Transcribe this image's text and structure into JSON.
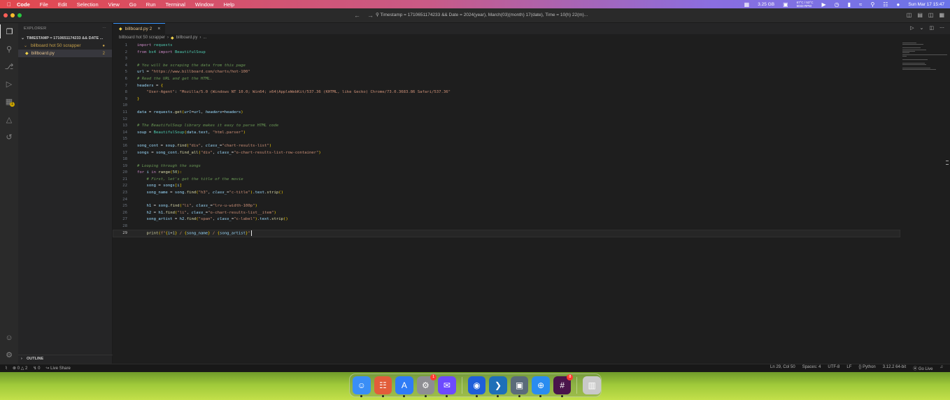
{
  "menubar": {
    "app": "Code",
    "items": [
      "File",
      "Edit",
      "Selection",
      "View",
      "Go",
      "Run",
      "Terminal",
      "Window",
      "Help"
    ],
    "memory": "3.25 GB",
    "temps": "67°C / 53°C",
    "fan": "5043 RPM",
    "datetime": "Sun Mar 17  15:47"
  },
  "titlebar": {
    "command_center": "Timestamp = 1710651174233 && Date = 2024(year), March(03)(month) 17(date), Time = 10(h) 22(m)..."
  },
  "sidebar": {
    "title": "EXPLORER",
    "workspace": "TIMESTAMP = 1710651174233 && DATE ...",
    "folder": "billboard hot 50 scrapper",
    "file": "billboard.py",
    "file_badge": "2",
    "outline": "OUTLINE"
  },
  "activity": {
    "extensions_badge": "1"
  },
  "editor": {
    "tab_label": "billboard.py 2",
    "breadcrumb_folder": "billboard hot 50 scrapper",
    "breadcrumb_file": "billboard.py",
    "breadcrumb_more": "...",
    "current_line": 29
  },
  "status": {
    "errors": "0",
    "warnings": "2",
    "ports": "0",
    "live_share": "Live Share",
    "position": "Ln 29, Col 50",
    "spaces": "Spaces: 4",
    "encoding": "UTF-8",
    "eol": "LF",
    "language": "Python",
    "interpreter": "3.12.2 64-bit",
    "go_live": "Go Live"
  },
  "dock": {
    "apps": [
      {
        "name": "Finder",
        "icon": "finder-icon",
        "color": "#3a8ef6"
      },
      {
        "name": "Launchpad",
        "icon": "launchpad-icon",
        "color": "#e25d3a"
      },
      {
        "name": "App Store",
        "icon": "app-store-icon",
        "color": "#2f7cf6"
      },
      {
        "name": "System Settings",
        "icon": "settings-icon",
        "color": "#8e8e93",
        "badge": "1"
      },
      {
        "name": "Proton Mail",
        "icon": "mail-icon",
        "color": "#6d4aff"
      },
      {
        "name": "Firefox",
        "icon": "firefox-icon",
        "color": "#1f5fd9"
      },
      {
        "name": "VS Code",
        "icon": "vscode-icon",
        "color": "#1e6fb8"
      },
      {
        "name": "Preview",
        "icon": "preview-icon",
        "color": "#5a6b7a"
      },
      {
        "name": "Safari",
        "icon": "safari-icon",
        "color": "#2a8cf0"
      },
      {
        "name": "Slack",
        "icon": "slack-icon",
        "color": "#4a154b",
        "badge": "8"
      },
      {
        "name": "Trash",
        "icon": "trash-icon",
        "color": "#c9c9c9"
      }
    ]
  },
  "code": [
    {
      "n": "1",
      "tokens": [
        [
          "kw",
          "import"
        ],
        [
          "op",
          " "
        ],
        [
          "mod",
          "requests"
        ]
      ]
    },
    {
      "n": "2",
      "tokens": [
        [
          "kw",
          "from"
        ],
        [
          "op",
          " "
        ],
        [
          "mod",
          "bs4"
        ],
        [
          "op",
          " "
        ],
        [
          "kw",
          "import"
        ],
        [
          "op",
          " "
        ],
        [
          "cls",
          "BeautifulSoup"
        ]
      ]
    },
    {
      "n": "3",
      "tokens": []
    },
    {
      "n": "4",
      "tokens": [
        [
          "cm",
          "# You will be scraping the data from this page"
        ]
      ]
    },
    {
      "n": "5",
      "tokens": [
        [
          "var",
          "url"
        ],
        [
          "op",
          " = "
        ],
        [
          "str",
          "\"https://www.billboard.com/charts/hot-100\""
        ]
      ]
    },
    {
      "n": "6",
      "tokens": [
        [
          "cm",
          "# Read the URL and get the HTML."
        ]
      ]
    },
    {
      "n": "7",
      "tokens": [
        [
          "var",
          "headers"
        ],
        [
          "op",
          " = "
        ],
        [
          "pn",
          "{"
        ]
      ]
    },
    {
      "n": "8",
      "tokens": [
        [
          "op",
          "    "
        ],
        [
          "str",
          "\"User-Agent\""
        ],
        [
          "op",
          ": "
        ],
        [
          "str",
          "\"Mozilla/5.0 (Windows NT 10.0; Win64; x64)AppleWebKit/537.36 (KHTML, like Gecko) Chrome/73.0.3683.86 Safari/537.36\""
        ]
      ]
    },
    {
      "n": "9",
      "tokens": [
        [
          "pn",
          "}"
        ]
      ]
    },
    {
      "n": "10",
      "tokens": []
    },
    {
      "n": "11",
      "tokens": [
        [
          "var",
          "data"
        ],
        [
          "op",
          " = "
        ],
        [
          "var",
          "requests"
        ],
        [
          "op",
          "."
        ],
        [
          "fn",
          "get"
        ],
        [
          "pn",
          "("
        ],
        [
          "prm",
          "url"
        ],
        [
          "op",
          "="
        ],
        [
          "var",
          "url"
        ],
        [
          "op",
          ", "
        ],
        [
          "prm",
          "headers"
        ],
        [
          "op",
          "="
        ],
        [
          "var",
          "headers"
        ],
        [
          "pn",
          ")"
        ]
      ]
    },
    {
      "n": "12",
      "tokens": []
    },
    {
      "n": "13",
      "tokens": [
        [
          "cm",
          "# The BeautifulSoup library makes it easy to parse HTML code"
        ]
      ]
    },
    {
      "n": "14",
      "tokens": [
        [
          "var",
          "soup"
        ],
        [
          "op",
          " = "
        ],
        [
          "cls",
          "BeautifulSoup"
        ],
        [
          "pn",
          "("
        ],
        [
          "var",
          "data"
        ],
        [
          "op",
          "."
        ],
        [
          "var",
          "text"
        ],
        [
          "op",
          ", "
        ],
        [
          "str",
          "\"html.parser\""
        ],
        [
          "pn",
          ")"
        ]
      ]
    },
    {
      "n": "15",
      "tokens": []
    },
    {
      "n": "16",
      "tokens": [
        [
          "var",
          "song_cont"
        ],
        [
          "op",
          " = "
        ],
        [
          "var",
          "soup"
        ],
        [
          "op",
          "."
        ],
        [
          "fn",
          "find"
        ],
        [
          "pn",
          "("
        ],
        [
          "str",
          "\"div\""
        ],
        [
          "op",
          ", "
        ],
        [
          "prm",
          "class_"
        ],
        [
          "op",
          "="
        ],
        [
          "str",
          "\"chart-results-list\""
        ],
        [
          "pn",
          ")"
        ]
      ]
    },
    {
      "n": "17",
      "tokens": [
        [
          "var",
          "songs"
        ],
        [
          "op",
          " = "
        ],
        [
          "var",
          "song_cont"
        ],
        [
          "op",
          "."
        ],
        [
          "fn",
          "find_all"
        ],
        [
          "pn",
          "("
        ],
        [
          "str",
          "\"div\""
        ],
        [
          "op",
          ", "
        ],
        [
          "prm",
          "class_"
        ],
        [
          "op",
          "="
        ],
        [
          "str",
          "\"o-chart-results-list-row-container\""
        ],
        [
          "pn",
          ")"
        ]
      ]
    },
    {
      "n": "18",
      "tokens": []
    },
    {
      "n": "19",
      "tokens": [
        [
          "cm",
          "# Looping through the songs"
        ]
      ]
    },
    {
      "n": "20",
      "tokens": [
        [
          "ctl",
          "for"
        ],
        [
          "op",
          " "
        ],
        [
          "var",
          "i"
        ],
        [
          "op",
          " "
        ],
        [
          "ctl",
          "in"
        ],
        [
          "op",
          " "
        ],
        [
          "fn",
          "range"
        ],
        [
          "pn",
          "("
        ],
        [
          "num",
          "50"
        ],
        [
          "pn",
          "):"
        ]
      ]
    },
    {
      "n": "21",
      "tokens": [
        [
          "op",
          "    "
        ],
        [
          "cm",
          "# First, let's get the title of the movie"
        ]
      ]
    },
    {
      "n": "22",
      "tokens": [
        [
          "op",
          "    "
        ],
        [
          "var",
          "song"
        ],
        [
          "op",
          " = "
        ],
        [
          "var",
          "songs"
        ],
        [
          "pn",
          "["
        ],
        [
          "var",
          "i"
        ],
        [
          "pn",
          "]"
        ]
      ]
    },
    {
      "n": "23",
      "tokens": [
        [
          "op",
          "    "
        ],
        [
          "var",
          "song_name"
        ],
        [
          "op",
          " = "
        ],
        [
          "var",
          "song"
        ],
        [
          "op",
          "."
        ],
        [
          "fn",
          "find"
        ],
        [
          "pn",
          "("
        ],
        [
          "str",
          "\"h3\""
        ],
        [
          "op",
          ", "
        ],
        [
          "prm",
          "class_"
        ],
        [
          "op",
          "="
        ],
        [
          "str",
          "\"c-title\""
        ],
        [
          "pn",
          ")"
        ],
        [
          "op",
          "."
        ],
        [
          "var",
          "text"
        ],
        [
          "op",
          "."
        ],
        [
          "fn",
          "strip"
        ],
        [
          "pn",
          "()"
        ]
      ]
    },
    {
      "n": "24",
      "tokens": []
    },
    {
      "n": "25",
      "tokens": [
        [
          "op",
          "    "
        ],
        [
          "var",
          "h1"
        ],
        [
          "op",
          " = "
        ],
        [
          "var",
          "song"
        ],
        [
          "op",
          "."
        ],
        [
          "fn",
          "find"
        ],
        [
          "pn",
          "("
        ],
        [
          "str",
          "\"li\""
        ],
        [
          "op",
          ", "
        ],
        [
          "prm",
          "class_"
        ],
        [
          "op",
          "="
        ],
        [
          "str",
          "\"lrv-u-width-100p\""
        ],
        [
          "pn",
          ")"
        ]
      ]
    },
    {
      "n": "26",
      "tokens": [
        [
          "op",
          "    "
        ],
        [
          "var",
          "h2"
        ],
        [
          "op",
          " = "
        ],
        [
          "var",
          "h1"
        ],
        [
          "op",
          "."
        ],
        [
          "fn",
          "find"
        ],
        [
          "pn",
          "("
        ],
        [
          "str",
          "\"li\""
        ],
        [
          "op",
          ", "
        ],
        [
          "prm",
          "class_"
        ],
        [
          "op",
          "="
        ],
        [
          "str",
          "\"o-chart-results-list__item\""
        ],
        [
          "pn",
          ")"
        ]
      ]
    },
    {
      "n": "27",
      "tokens": [
        [
          "op",
          "    "
        ],
        [
          "var",
          "song_artist"
        ],
        [
          "op",
          " = "
        ],
        [
          "var",
          "h2"
        ],
        [
          "op",
          "."
        ],
        [
          "fn",
          "find"
        ],
        [
          "pn",
          "("
        ],
        [
          "str",
          "\"span\""
        ],
        [
          "op",
          ", "
        ],
        [
          "prm",
          "class_"
        ],
        [
          "op",
          "="
        ],
        [
          "str",
          "\"c-label\""
        ],
        [
          "pn",
          ")"
        ],
        [
          "op",
          "."
        ],
        [
          "var",
          "text"
        ],
        [
          "op",
          "."
        ],
        [
          "fn",
          "strip"
        ],
        [
          "pn",
          "()"
        ]
      ]
    },
    {
      "n": "28",
      "tokens": []
    },
    {
      "n": "29",
      "tokens": [
        [
          "op",
          "    "
        ],
        [
          "fn",
          "print"
        ],
        [
          "pn",
          "("
        ],
        [
          "str",
          "f\""
        ],
        [
          "pn",
          "{"
        ],
        [
          "var",
          "i"
        ],
        [
          "op",
          "+"
        ],
        [
          "num",
          "1"
        ],
        [
          "pn",
          "}"
        ],
        [
          "str",
          " / "
        ],
        [
          "pn",
          "{"
        ],
        [
          "var",
          "song_name"
        ],
        [
          "pn",
          "}"
        ],
        [
          "str",
          " / "
        ],
        [
          "pn",
          "{"
        ],
        [
          "var",
          "song_artist"
        ],
        [
          "pn",
          "}"
        ],
        [
          "str",
          "\""
        ]
      ]
    }
  ]
}
